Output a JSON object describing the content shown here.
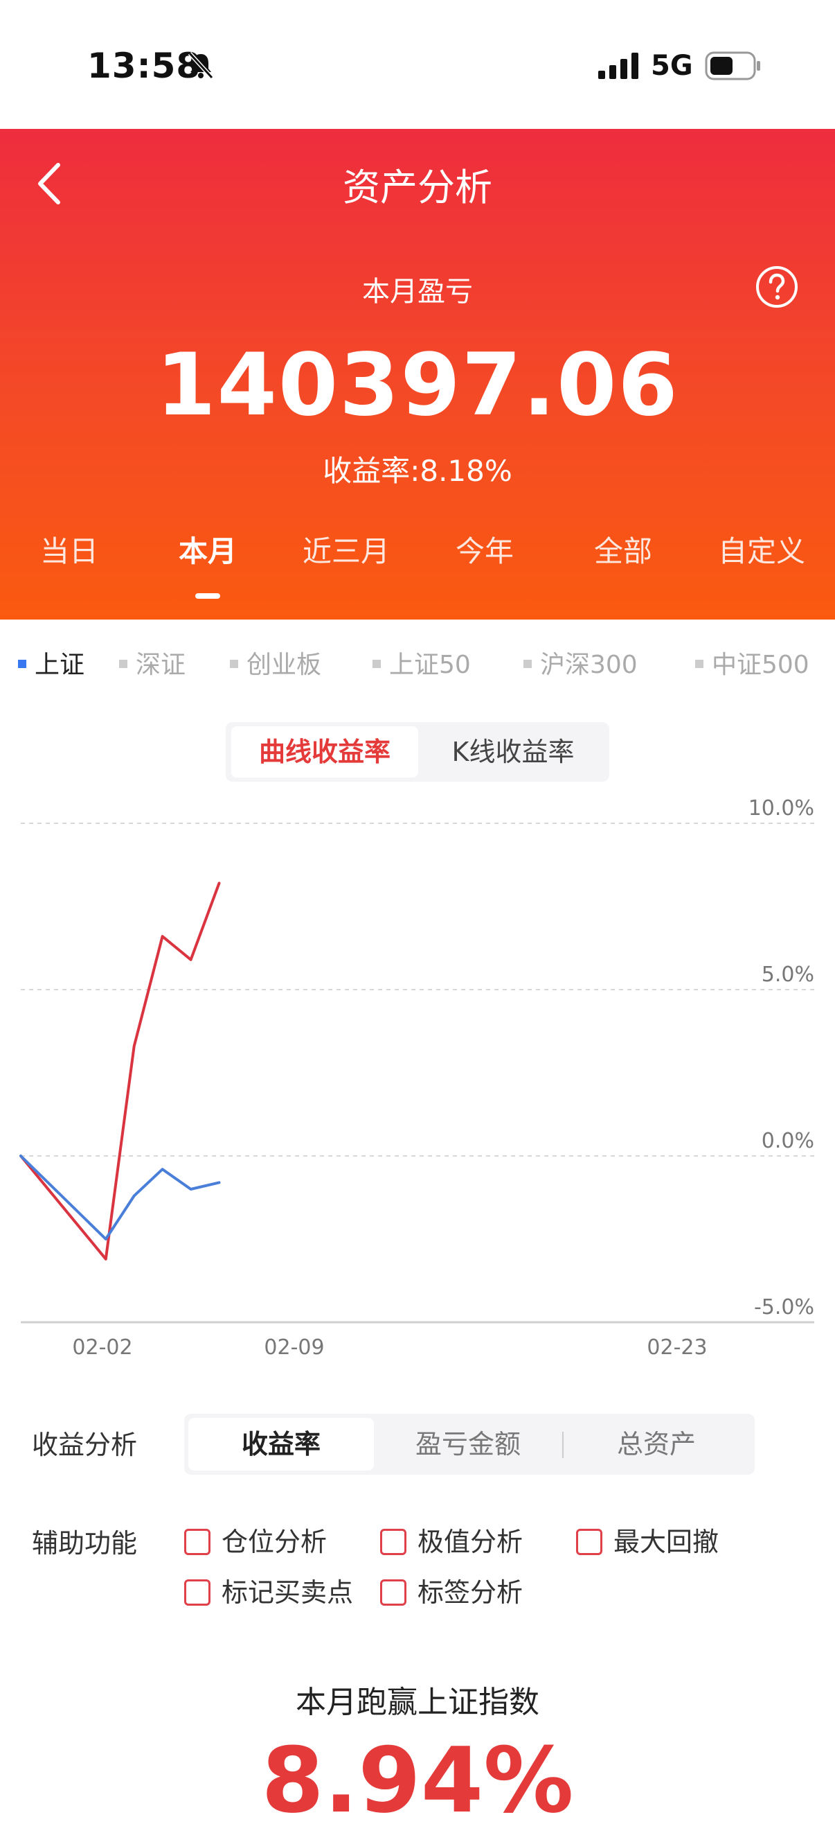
{
  "status_bar": {
    "time": "13:58",
    "network": "5G"
  },
  "header": {
    "title": "资产分析",
    "period_label": "本月盈亏",
    "pnl_value": "140397.06",
    "return_rate": "收益率:8.18%",
    "tabs": [
      {
        "label": "当日",
        "active": false
      },
      {
        "label": "本月",
        "active": true
      },
      {
        "label": "近三月",
        "active": false
      },
      {
        "label": "今年",
        "active": false
      },
      {
        "label": "全部",
        "active": false
      },
      {
        "label": "自定义",
        "active": false
      }
    ]
  },
  "index_tabs": [
    {
      "label": "上证",
      "active": true
    },
    {
      "label": "深证",
      "active": false
    },
    {
      "label": "创业板",
      "active": false
    },
    {
      "label": "上证50",
      "active": false
    },
    {
      "label": "沪深300",
      "active": false
    },
    {
      "label": "中证500",
      "active": false
    }
  ],
  "chart_toggle": {
    "active": "曲线收益率",
    "inactive": "K线收益率"
  },
  "chart_data": {
    "type": "line",
    "x_tick_labels": [
      "02-02",
      "02-09",
      "02-23"
    ],
    "y_tick_labels": [
      "10.0%",
      "5.0%",
      "0.0%",
      "-5.0%"
    ],
    "ylim": [
      -5.0,
      10.0
    ],
    "grid": true,
    "series": [
      {
        "color": "#d9343f",
        "x": [
          0,
          3,
          4,
          5,
          6,
          7
        ],
        "values": [
          0.0,
          -3.1,
          3.3,
          6.6,
          5.9,
          8.2
        ]
      },
      {
        "color": "#4a7fd9",
        "x": [
          0,
          3,
          4,
          5,
          6,
          7
        ],
        "values": [
          0.0,
          -2.5,
          -1.2,
          -0.4,
          -1.0,
          -0.8
        ]
      }
    ],
    "x_range": [
      0,
      28
    ]
  },
  "profit_analysis": {
    "label": "收益分析",
    "options": [
      {
        "label": "收益率",
        "active": true
      },
      {
        "label": "盈亏金额",
        "active": false
      },
      {
        "label": "总资产",
        "active": false
      }
    ]
  },
  "aux_functions": {
    "label": "辅助功能",
    "items": [
      "仓位分析",
      "极值分析",
      "最大回撤",
      "标记买卖点",
      "标签分析"
    ]
  },
  "beat_index": {
    "title": "本月跑赢上证指数",
    "value": "8.94%"
  },
  "colors": {
    "accent": "#e53a3a",
    "header_top": "#ee2d3e",
    "header_bottom": "#fa5a10",
    "index_active": "#3a78f2"
  }
}
